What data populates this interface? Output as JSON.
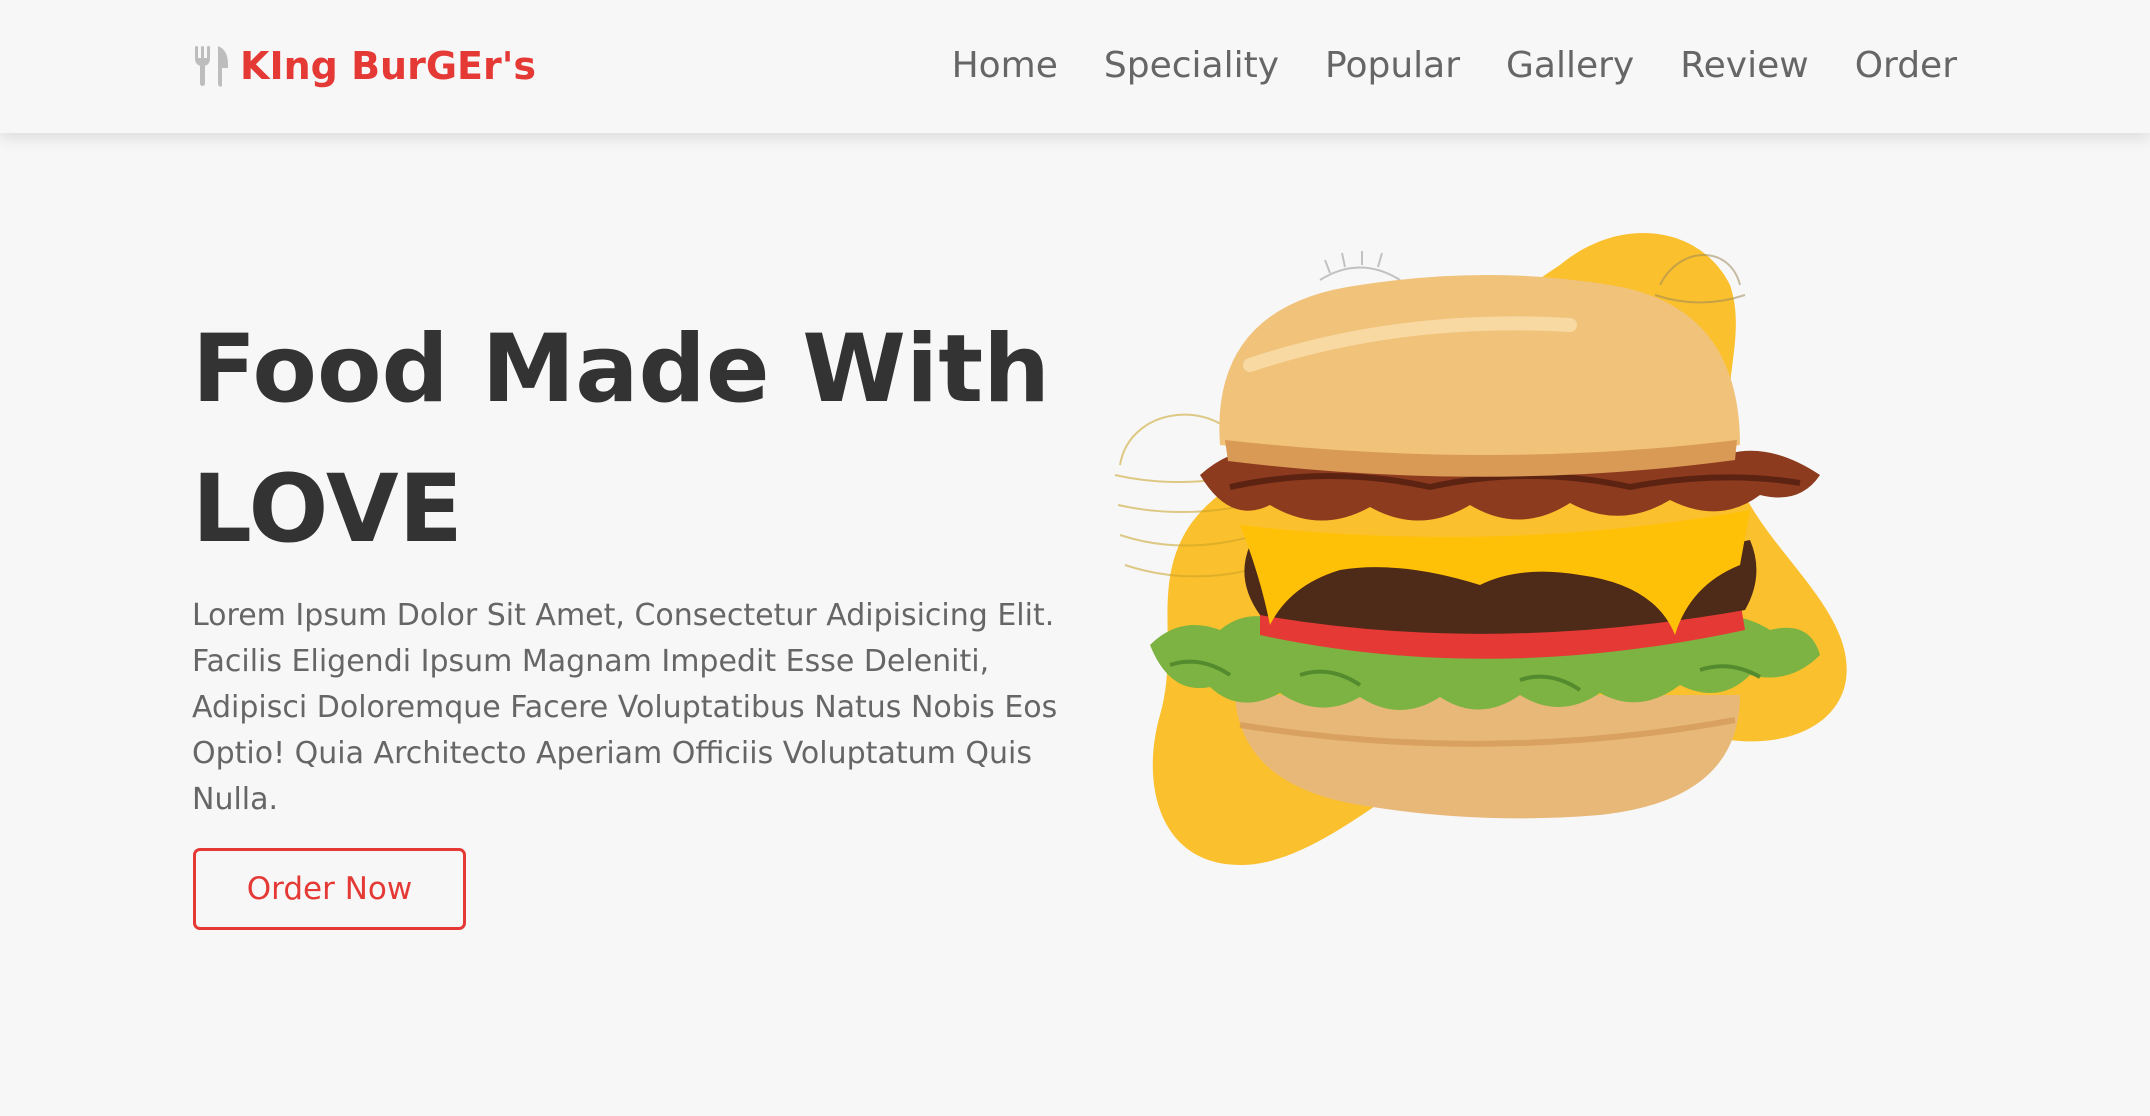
{
  "header": {
    "brand": "KIng BurGEr's",
    "logo_icon": "utensils-icon",
    "nav": [
      "Home",
      "Speciality",
      "Popular",
      "Gallery",
      "Review",
      "Order"
    ]
  },
  "hero": {
    "title_line1": "Food Made With",
    "title_line2": "LOVE",
    "description": "Lorem Ipsum Dolor Sit Amet, Consectetur Adipisicing Elit. Facilis Eligendi Ipsum Magnam Impedit Esse Deleniti, Adipisci Doloremque Facere Voluptatibus Natus Nobis Eos Optio! Quia Architecto Aperiam Officiis Voluptatum Quis Nulla.",
    "button": "Order Now"
  },
  "colors": {
    "brand": "#e53935",
    "blob": "#fbc02d",
    "text_dark": "#333333",
    "text_muted": "#666666",
    "background": "#f7f7f7"
  }
}
